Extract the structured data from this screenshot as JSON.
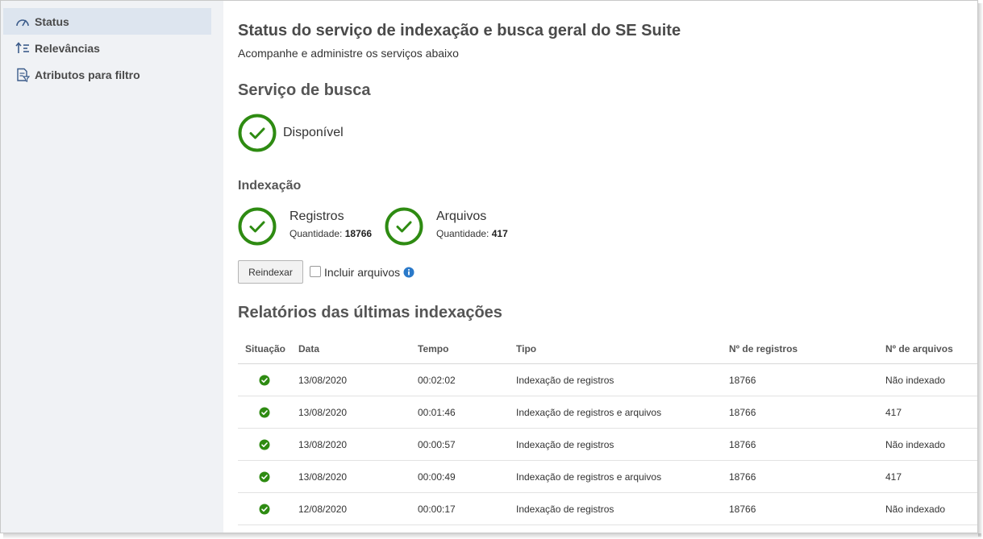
{
  "sidebar": {
    "items": [
      {
        "label": "Status",
        "icon": "gauge-icon",
        "active": true
      },
      {
        "label": "Relevâncias",
        "icon": "sort-relevance-icon",
        "active": false
      },
      {
        "label": "Atributos para filtro",
        "icon": "filter-attributes-icon",
        "active": false
      }
    ]
  },
  "header": {
    "title": "Status do serviço de indexação e busca geral do SE Suite",
    "subtitle": "Acompanhe e administre os serviços abaixo"
  },
  "search_service": {
    "title": "Serviço de busca",
    "status": "Disponível"
  },
  "indexing": {
    "title": "Indexação",
    "records": {
      "label": "Registros",
      "qty_label": "Quantidade:",
      "qty": "18766"
    },
    "files": {
      "label": "Arquivos",
      "qty_label": "Quantidade:",
      "qty": "417"
    },
    "reindex_button": "Reindexar",
    "include_files_label": "Incluir arquivos"
  },
  "reports": {
    "title": "Relatórios das últimas indexações",
    "columns": [
      "Situação",
      "Data",
      "Tempo",
      "Tipo",
      "Nº de registros",
      "Nº de arquivos"
    ],
    "rows": [
      {
        "date": "13/08/2020",
        "time": "00:02:02",
        "type": "Indexação de registros",
        "records": "18766",
        "files": "Não indexado"
      },
      {
        "date": "13/08/2020",
        "time": "00:01:46",
        "type": "Indexação de registros e arquivos",
        "records": "18766",
        "files": "417"
      },
      {
        "date": "13/08/2020",
        "time": "00:00:57",
        "type": "Indexação de registros",
        "records": "18766",
        "files": "Não indexado"
      },
      {
        "date": "13/08/2020",
        "time": "00:00:49",
        "type": "Indexação de registros e arquivos",
        "records": "18766",
        "files": "417"
      },
      {
        "date": "12/08/2020",
        "time": "00:00:17",
        "type": "Indexação de registros",
        "records": "18766",
        "files": "Não indexado"
      }
    ]
  },
  "colors": {
    "success": "#2e8b12",
    "info": "#2a79c9",
    "sidebar_bg": "#f0f2f5",
    "sidebar_active": "#dde5ef"
  }
}
